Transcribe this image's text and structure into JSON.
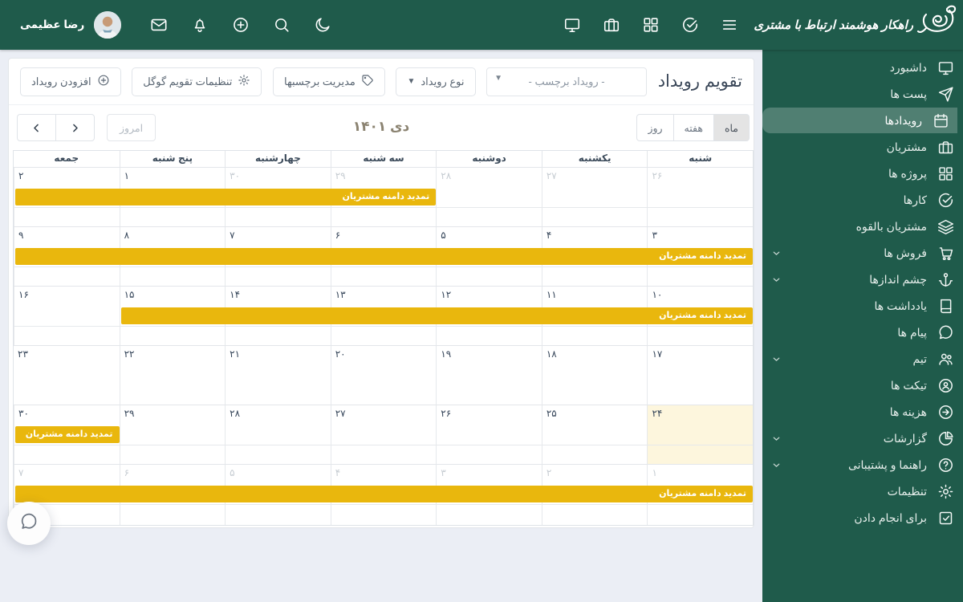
{
  "topbar": {
    "user_name": "رضا عظیمی",
    "logo_text": "راهکار هوشمند ارتباط با مشتری"
  },
  "sidebar": {
    "items": [
      {
        "id": "dashboard",
        "label": "داشبورد",
        "icon": "monitor",
        "active": false,
        "submenu": false
      },
      {
        "id": "posts",
        "label": "پست ها",
        "icon": "send",
        "active": false,
        "submenu": false
      },
      {
        "id": "events",
        "label": "رویدادها",
        "icon": "calendar",
        "active": true,
        "submenu": false
      },
      {
        "id": "customers",
        "label": "مشتریان",
        "icon": "briefcase",
        "active": false,
        "submenu": false
      },
      {
        "id": "projects",
        "label": "پروژه ها",
        "icon": "grid",
        "active": false,
        "submenu": false
      },
      {
        "id": "tasks",
        "label": "کارها",
        "icon": "check-circle",
        "active": false,
        "submenu": false
      },
      {
        "id": "leads",
        "label": "مشتریان بالقوه",
        "icon": "layers",
        "active": false,
        "submenu": false
      },
      {
        "id": "sales",
        "label": "فروش ها",
        "icon": "cart",
        "active": false,
        "submenu": true
      },
      {
        "id": "prospects",
        "label": "چشم اندازها",
        "icon": "anchor",
        "active": false,
        "submenu": true
      },
      {
        "id": "notes",
        "label": "یادداشت ها",
        "icon": "book",
        "active": false,
        "submenu": false
      },
      {
        "id": "messages",
        "label": "پیام ها",
        "icon": "chat",
        "active": false,
        "submenu": false
      },
      {
        "id": "team",
        "label": "تیم",
        "icon": "users",
        "active": false,
        "submenu": true
      },
      {
        "id": "tickets",
        "label": "تیکت ها",
        "icon": "ticket",
        "active": false,
        "submenu": false
      },
      {
        "id": "expenses",
        "label": "هزینه ها",
        "icon": "arrow-circle",
        "active": false,
        "submenu": false
      },
      {
        "id": "reports",
        "label": "گزارشات",
        "icon": "pie",
        "active": false,
        "submenu": true
      },
      {
        "id": "help",
        "label": "راهنما و پشتیبانی",
        "icon": "help",
        "active": false,
        "submenu": true
      },
      {
        "id": "settings",
        "label": "تنظیمات",
        "icon": "gear",
        "active": false,
        "submenu": false
      },
      {
        "id": "todo",
        "label": "برای انجام دادن",
        "icon": "todo",
        "active": false,
        "submenu": false
      }
    ]
  },
  "toolbar": {
    "title": "تقویم رویداد",
    "label_filter_value": "- رویداد برچسب -",
    "event_type_label": "نوع رویداد",
    "manage_labels_label": "مدیریت برچسبها",
    "google_settings_label": "تنظیمات تقویم گوگل",
    "add_event_label": "افزودن رویداد"
  },
  "calendar": {
    "today_label": "امروز",
    "month_title": "دی ۱۴۰۱",
    "views": [
      {
        "label": "روز",
        "active": false
      },
      {
        "label": "هفته",
        "active": false
      },
      {
        "label": "ماه",
        "active": true
      }
    ],
    "day_headers": [
      "شنبه",
      "یکشنبه",
      "دوشنبه",
      "سه شنبه",
      "چهارشنبه",
      "پنج شنبه",
      "جمعه"
    ],
    "weeks": [
      {
        "days": [
          {
            "num": "۲۶",
            "muted": true
          },
          {
            "num": "۲۷",
            "muted": true
          },
          {
            "num": "۲۸",
            "muted": true
          },
          {
            "num": "۲۹",
            "muted": true
          },
          {
            "num": "۳۰",
            "muted": true
          },
          {
            "num": "۱"
          },
          {
            "num": "۲"
          }
        ],
        "events": [
          {
            "label": "تمدید دامنه مشتریان",
            "col": 3,
            "span": 4
          }
        ]
      },
      {
        "days": [
          {
            "num": "۳"
          },
          {
            "num": "۴"
          },
          {
            "num": "۵"
          },
          {
            "num": "۶"
          },
          {
            "num": "۷"
          },
          {
            "num": "۸"
          },
          {
            "num": "۹"
          }
        ],
        "events": [
          {
            "label": "تمدید دامنه مشتریان",
            "col": 0,
            "span": 7
          }
        ]
      },
      {
        "days": [
          {
            "num": "۱۰"
          },
          {
            "num": "۱۱"
          },
          {
            "num": "۱۲"
          },
          {
            "num": "۱۳"
          },
          {
            "num": "۱۴"
          },
          {
            "num": "۱۵"
          },
          {
            "num": "۱۶"
          }
        ],
        "events": [
          {
            "label": "تمدید دامنه مشتریان",
            "col": 0,
            "span": 6
          }
        ]
      },
      {
        "days": [
          {
            "num": "۱۷"
          },
          {
            "num": "۱۸"
          },
          {
            "num": "۱۹"
          },
          {
            "num": "۲۰"
          },
          {
            "num": "۲۱"
          },
          {
            "num": "۲۲"
          },
          {
            "num": "۲۳"
          }
        ],
        "events": []
      },
      {
        "days": [
          {
            "num": "۲۴",
            "today": true
          },
          {
            "num": "۲۵"
          },
          {
            "num": "۲۶"
          },
          {
            "num": "۲۷"
          },
          {
            "num": "۲۸"
          },
          {
            "num": "۲۹"
          },
          {
            "num": "۳۰"
          }
        ],
        "events": [
          {
            "label": "تمدید دامنه مشتریان",
            "col": 6,
            "span": 1
          }
        ]
      },
      {
        "days": [
          {
            "num": "۱",
            "muted": true
          },
          {
            "num": "۲",
            "muted": true
          },
          {
            "num": "۳",
            "muted": true
          },
          {
            "num": "۴",
            "muted": true
          },
          {
            "num": "۵",
            "muted": true
          },
          {
            "num": "۶",
            "muted": true
          },
          {
            "num": "۷",
            "muted": true
          }
        ],
        "events": [
          {
            "label": "تمدید دامنه مشتریان",
            "col": 0,
            "span": 7
          }
        ]
      }
    ]
  },
  "colors": {
    "brand_green": "#1f5b4b",
    "event_yellow": "#e9b70d",
    "today_bg": "#fdf6dd"
  }
}
